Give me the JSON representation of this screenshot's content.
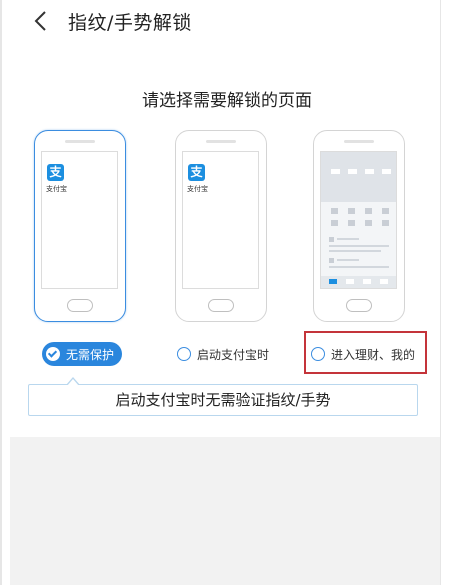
{
  "header": {
    "title": "指纹/手势解锁",
    "back_icon": "chevron-left-icon"
  },
  "prompt": "请选择需要解锁的页面",
  "phones": [
    {
      "app_label": "支付宝",
      "icon_glyph": "支"
    },
    {
      "app_label": "支付宝",
      "icon_glyph": "支"
    },
    {
      "app_label": ""
    }
  ],
  "options": [
    {
      "label": "无需保护",
      "selected": true
    },
    {
      "label": "启动支付宝时",
      "selected": false
    },
    {
      "label": "进入理财、我的",
      "selected": false
    }
  ],
  "tooltip": "启动支付宝时无需验证指纹/手势",
  "colors": {
    "accent": "#2a86dd",
    "highlight": "#c4343a",
    "app_icon": "#1c8fe0"
  }
}
